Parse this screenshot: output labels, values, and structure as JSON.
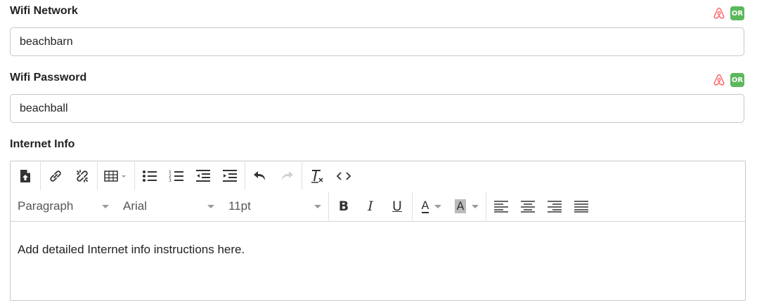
{
  "wifi_network": {
    "label": "Wifi Network",
    "value": "beachbarn",
    "or_badge": "OR",
    "icons": [
      "airbnb-icon",
      "or-badge"
    ]
  },
  "wifi_password": {
    "label": "Wifi Password",
    "value": "beachball",
    "or_badge": "OR",
    "icons": [
      "airbnb-icon",
      "or-badge"
    ]
  },
  "internet_info": {
    "label": "Internet Info",
    "content": "Add detailed Internet info instructions here."
  },
  "toolbar": {
    "row1_icons": [
      "insert-file-icon",
      "link-icon",
      "unlink-icon",
      "table-icon",
      "bullet-list-icon",
      "numbered-list-icon",
      "outdent-icon",
      "indent-icon",
      "undo-icon",
      "redo-icon",
      "clear-formatting-icon",
      "source-code-icon"
    ],
    "block_format": "Paragraph",
    "font_family": "Arial",
    "font_size": "11pt",
    "bold": "B",
    "italic": "I",
    "underline": "U",
    "text_color": "A",
    "background_color": "A",
    "row2_icons": [
      "bold-icon",
      "italic-icon",
      "underline-icon",
      "text-color-icon",
      "background-color-icon",
      "align-left-icon",
      "align-center-icon",
      "align-right-icon",
      "align-justify-icon"
    ]
  },
  "colors": {
    "airbnb": "#ff5a5f",
    "or_badge": "#5cb85c",
    "border": "#c8c8c8"
  }
}
